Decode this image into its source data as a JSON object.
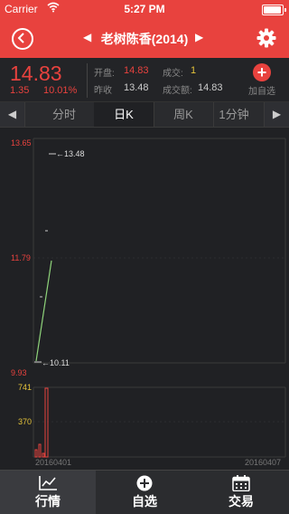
{
  "status_bar": {
    "carrier": "Carrier",
    "time": "5:27 PM"
  },
  "nav": {
    "title": "老树陈香(2014)"
  },
  "quote": {
    "price": "14.83",
    "change": "1.35",
    "change_pct": "10.01%",
    "open_label": "开盘:",
    "open_value": "14.83",
    "volume_label": "成交:",
    "volume_value": "1",
    "prev_close_label": "昨收",
    "prev_close_value": "13.48",
    "turnover_label": "成交额:",
    "turnover_value": "14.83",
    "add_watch_label": "加自选"
  },
  "tabs": [
    {
      "label": "分时"
    },
    {
      "label": "日K"
    },
    {
      "label": "周K"
    },
    {
      "label": "1分钟"
    }
  ],
  "chart": {
    "y_top": "13.65",
    "y_mid": "11.79",
    "y_bottom": "9.93",
    "max_annotation": "13.48",
    "min_annotation": "10.11",
    "vol_top": "741",
    "vol_mid": "370",
    "date_start": "20160401",
    "date_end": "20160407"
  },
  "chart_data": {
    "type": "line",
    "price_axis": {
      "min": 9.93,
      "mid": 11.79,
      "max": 13.65
    },
    "volume_axis": {
      "mid": 370,
      "max": 741
    },
    "annotations": [
      {
        "label": "13.48"
      },
      {
        "label": "10.11"
      }
    ],
    "x_labels": [
      "20160401",
      "20160407"
    ]
  },
  "bottom_tabs": [
    {
      "label": "行情",
      "icon": "chart-trend-icon"
    },
    {
      "label": "自选",
      "icon": "plus-circle-icon"
    },
    {
      "label": "交易",
      "icon": "calendar-icon"
    }
  ],
  "colors": {
    "accent": "#e8423e",
    "yellow": "#e3c23a",
    "line": "#8ed37a"
  }
}
